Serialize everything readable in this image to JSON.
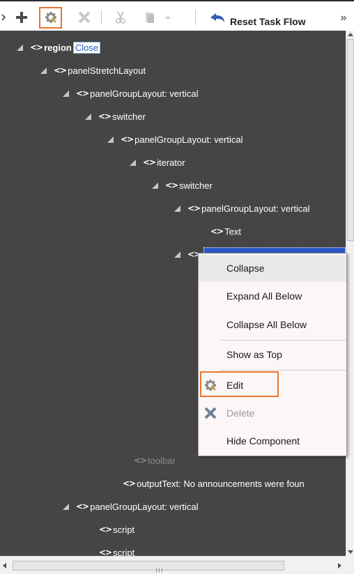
{
  "toolbar": {
    "reset_label": "Reset Task Flow",
    "overflow_label": "»",
    "icons": [
      "plus-icon",
      "gear-icon",
      "close-icon",
      "cut-icon",
      "paste-icon",
      "dropdown-icon",
      "reset-icon"
    ]
  },
  "tree": {
    "nodes": [
      {
        "tag": "<>",
        "label": "region",
        "action": "Close"
      },
      {
        "tag": "<>",
        "label": "panelStretchLayout"
      },
      {
        "tag": "<>",
        "label": "panelGroupLayout: vertical"
      },
      {
        "tag": "<>",
        "label": "switcher"
      },
      {
        "tag": "<>",
        "label": "panelGroupLayout: vertical"
      },
      {
        "tag": "<>",
        "label": "iterator"
      },
      {
        "tag": "<>",
        "label": "switcher"
      },
      {
        "tag": "<>",
        "label": "panelGroupLayout: vertical"
      },
      {
        "tag": "<>",
        "label": "Text"
      },
      {
        "tag": "<>",
        "label": ""
      },
      {
        "tag": "<>",
        "label": "toolbar"
      },
      {
        "tag": "<>",
        "label": "outputText: No announcements were foun"
      },
      {
        "tag": "<>",
        "label": "panelGroupLayout: vertical"
      },
      {
        "tag": "<>",
        "label": "script"
      },
      {
        "tag": "<>",
        "label": "script"
      }
    ]
  },
  "context_menu": {
    "items": [
      {
        "label": "Collapse"
      },
      {
        "label": "Expand All Below"
      },
      {
        "label": "Collapse All Below"
      },
      {
        "label": "Show as Top"
      },
      {
        "label": "Edit",
        "icon": "gear-icon"
      },
      {
        "label": "Delete",
        "icon": "close-icon"
      },
      {
        "label": "Hide Component"
      }
    ]
  },
  "colors": {
    "tree_background": "#454545",
    "highlight_outline": "#e8772e",
    "selection": "#2d56c5",
    "link": "#1f5fbf"
  }
}
